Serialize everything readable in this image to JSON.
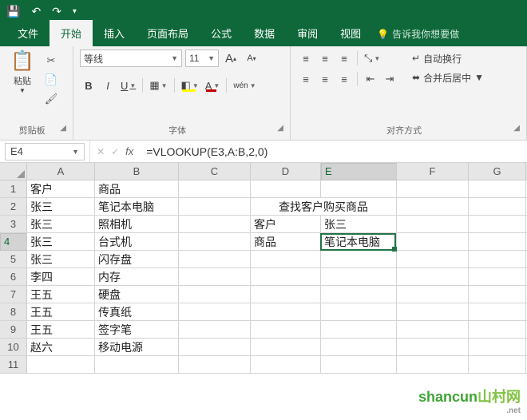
{
  "titlebar": {
    "save_icon": "💾",
    "undo_icon": "↶",
    "redo_icon": "↷",
    "customize_icon": "▾"
  },
  "tabs": {
    "file": "文件",
    "home": "开始",
    "insert": "插入",
    "pagelayout": "页面布局",
    "formulas": "公式",
    "data": "数据",
    "review": "审阅",
    "view": "视图",
    "tellme": "告诉我你想要做"
  },
  "ribbon": {
    "clipboard": {
      "label": "剪贴板",
      "paste": "粘贴",
      "cut_icon": "✂",
      "copy_icon": "📄",
      "fmtpainter_icon": "🖌"
    },
    "font": {
      "label": "字体",
      "name": "等线",
      "size": "11",
      "grow_icon": "A",
      "shrink_icon": "A",
      "bold": "B",
      "italic": "I",
      "underline": "U",
      "border_icon": "▦",
      "fill_icon": "◧",
      "fontcolor_icon": "A",
      "phonetic_icon": "wén"
    },
    "align": {
      "label": "对齐方式",
      "top_icon": "≡",
      "mid_icon": "≡",
      "bot_icon": "≡",
      "left_icon": "≡",
      "center_icon": "≡",
      "right_icon": "≡",
      "orient_icon": "⤡",
      "indentl_icon": "⇤",
      "indentr_icon": "⇥",
      "wrap": "自动换行",
      "wrap_icon": "↵",
      "merge": "合并后居中",
      "merge_icon": "⬌"
    }
  },
  "namebox": "E4",
  "formula": "=VLOOKUP(E3,A:B,2,0)",
  "columns": [
    "A",
    "B",
    "C",
    "D",
    "E",
    "F",
    "G"
  ],
  "rows": [
    {
      "n": "1",
      "A": "客户",
      "B": "商品"
    },
    {
      "n": "2",
      "A": "张三",
      "B": "笔记本电脑",
      "D": "查找客户购买商品",
      "DE_merge": true
    },
    {
      "n": "3",
      "A": "张三",
      "B": "照相机",
      "D": "客户",
      "E": "张三"
    },
    {
      "n": "4",
      "A": "张三",
      "B": "台式机",
      "D": "商品",
      "E": "笔记本电脑"
    },
    {
      "n": "5",
      "A": "张三",
      "B": "闪存盘"
    },
    {
      "n": "6",
      "A": "李四",
      "B": "内存"
    },
    {
      "n": "7",
      "A": "王五",
      "B": "硬盘"
    },
    {
      "n": "8",
      "A": "王五",
      "B": "传真纸"
    },
    {
      "n": "9",
      "A": "王五",
      "B": "签字笔"
    },
    {
      "n": "10",
      "A": "赵六",
      "B": "移动电源"
    },
    {
      "n": "11"
    }
  ],
  "watermark": {
    "brand": "shancun",
    "suffix": "山村网",
    "domain": ".net"
  }
}
